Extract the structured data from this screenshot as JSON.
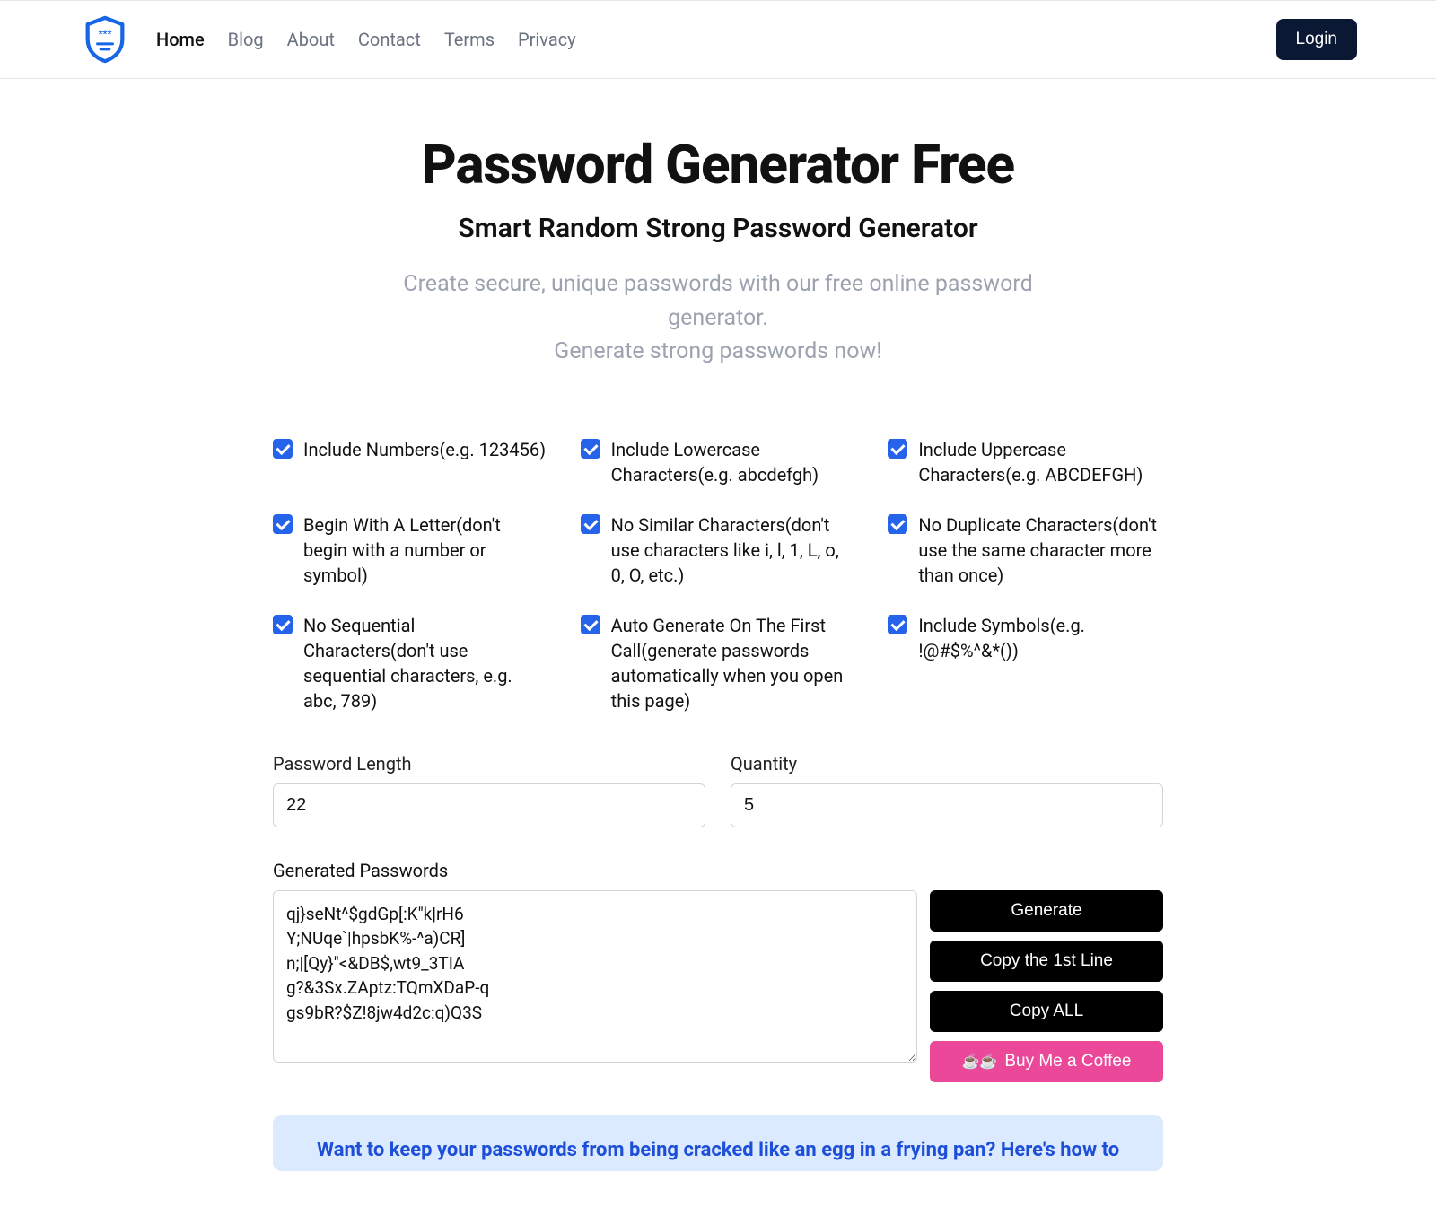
{
  "nav": {
    "items": [
      {
        "label": "Home",
        "active": true
      },
      {
        "label": "Blog",
        "active": false
      },
      {
        "label": "About",
        "active": false
      },
      {
        "label": "Contact",
        "active": false
      },
      {
        "label": "Terms",
        "active": false
      },
      {
        "label": "Privacy",
        "active": false
      }
    ],
    "login": "Login"
  },
  "hero": {
    "title": "Password Generator Free",
    "subtitle": "Smart Random Strong Password Generator",
    "desc1": "Create secure, unique passwords with our free online password generator.",
    "desc2": "Generate strong passwords now!"
  },
  "options": [
    {
      "label": "Include Numbers(e.g. 123456)"
    },
    {
      "label": "Include Lowercase Characters(e.g. abcdefgh)"
    },
    {
      "label": "Include Uppercase Characters(e.g. ABCDEFGH)"
    },
    {
      "label": "Begin With A Letter(don't begin with a number or symbol)"
    },
    {
      "label": "No Similar Characters(don't use characters like i, l, 1, L, o, 0, O, etc.)"
    },
    {
      "label": "No Duplicate Characters(don't use the same character more than once)"
    },
    {
      "label": "No Sequential Characters(don't use sequential characters, e.g. abc, 789)"
    },
    {
      "label": "Auto Generate On The First Call(generate passwords automatically when you open this page)"
    },
    {
      "label": "Include Symbols(e.g. !@#$%^&*())"
    }
  ],
  "inputs": {
    "length_label": "Password Length",
    "length_value": "22",
    "quantity_label": "Quantity",
    "quantity_value": "5"
  },
  "generated": {
    "label": "Generated Passwords",
    "value": "qj}seNt^$gdGp[:K\"k|rH6\nY;NUqe`|hpsbK%-^a)CR]\nn;|[Qy}\"<&DB$,wt9_3TIA\ng?&3Sx.ZAptz:TQmXDaP-q\ngs9bR?$Z!8jw4d2c:q)Q3S"
  },
  "buttons": {
    "generate": "Generate",
    "copy_first": "Copy the 1st Line",
    "copy_all": "Copy ALL",
    "coffee": "Buy Me a Coffee"
  },
  "info": {
    "text": "Want to keep your passwords from being cracked like an egg in a frying pan? Here's how to"
  }
}
